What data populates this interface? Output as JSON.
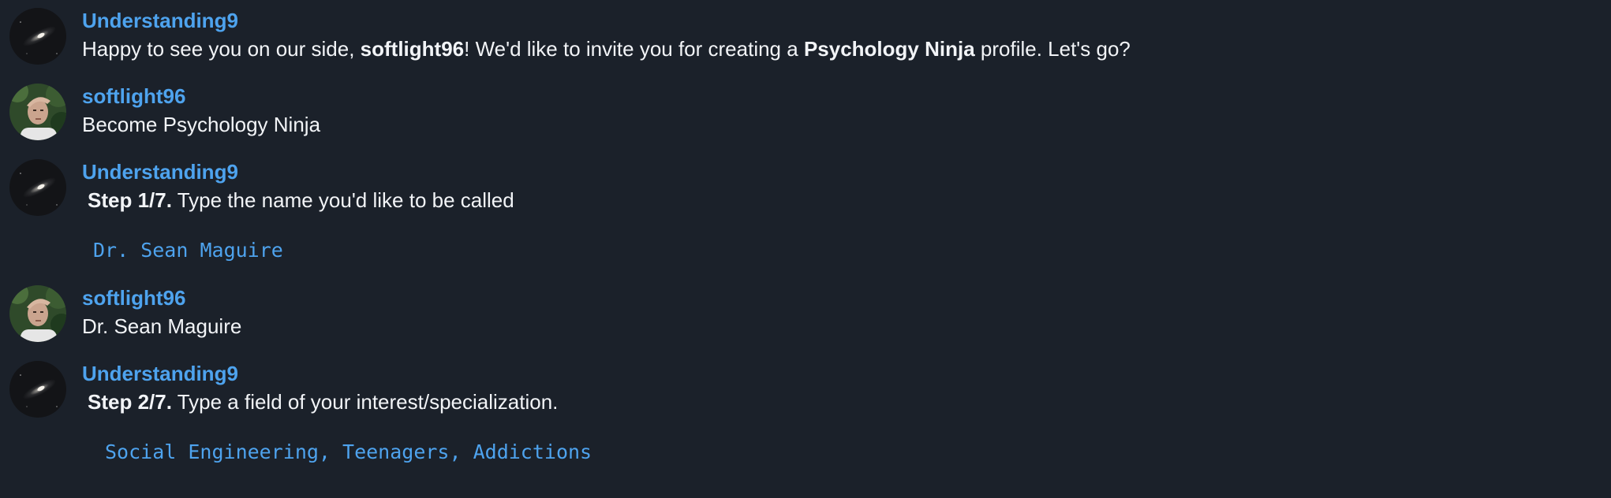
{
  "messages": [
    {
      "author": "Understanding9",
      "parts": {
        "p1": "Happy to see you on our side, ",
        "b1": "softlight96",
        "p2": "! We'd like to invite you for creating a ",
        "b2": "Psychology Ninja",
        "p3": " profile. Let's go?"
      }
    },
    {
      "author": "softlight96",
      "text": "Become Psychology Ninja"
    },
    {
      "author": "Understanding9",
      "step": "Step 1/7.",
      "text": " Type the name you'd like to be called",
      "code": "Dr. Sean Maguire"
    },
    {
      "author": "softlight96",
      "text": "Dr. Sean Maguire"
    },
    {
      "author": "Understanding9",
      "step": "Step 2/7.",
      "text": " Type a field of your interest/specialization.",
      "code": "Social Engineering, Teenagers, Addictions"
    }
  ],
  "colors": {
    "background": "#1b212a",
    "author": "#4ea3ee",
    "text": "#f2f4f7",
    "code": "#4ea3ee"
  },
  "icons": {
    "bot_avatar": "galaxy-avatar-icon",
    "user_avatar": "user-photo-avatar-icon"
  }
}
